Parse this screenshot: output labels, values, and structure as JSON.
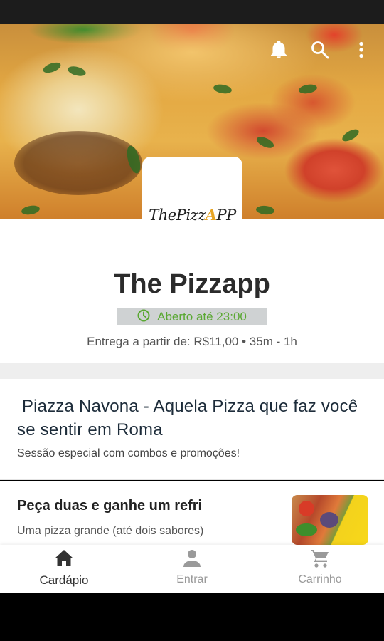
{
  "restaurant": {
    "name": "The Pizzapp",
    "logo_text_main": "ThePizz",
    "logo_text_accent": "A",
    "logo_text_tail": "PP",
    "open_status": "Aberto até 23:00",
    "delivery_info": "Entrega a partir de: R$11,00 • 35m - 1h"
  },
  "header_icons": [
    "bell-icon",
    "search-icon",
    "more-vert-icon"
  ],
  "section": {
    "title": " Piazza Navona - Aquela Pizza que faz você se sentir em Roma",
    "subtitle": "Sessão especial com combos e promoções!"
  },
  "product": {
    "title": "Peça duas e ganhe um refri",
    "description": "Uma pizza grande (até dois sabores)"
  },
  "bottom_nav": {
    "items": [
      {
        "label": "Cardápio",
        "icon": "home-icon",
        "active": true
      },
      {
        "label": "Entrar",
        "icon": "person-icon",
        "active": false
      },
      {
        "label": "Carrinho",
        "icon": "cart-icon",
        "active": false
      }
    ]
  },
  "colors": {
    "open_green": "#5aa832",
    "badge_bg": "#cfd2d3",
    "title_text": "#2b2b2b",
    "section_title": "#1d2c3a"
  }
}
